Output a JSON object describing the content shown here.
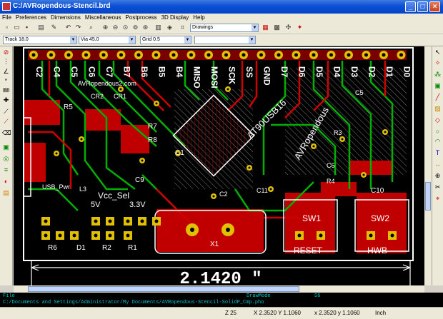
{
  "window": {
    "title": "C:/AVRopendous-Stencil.brd"
  },
  "menu": [
    "File",
    "Preferences",
    "Dimensions",
    "Miscellaneous",
    "Postprocess",
    "3D Display",
    "Help"
  ],
  "toolbar2": {
    "track": "Track 18.0",
    "via": "Via 45.0",
    "grid": "Grid 0.5",
    "empty": ""
  },
  "toolbar1": {
    "layer_combo": "Drawings"
  },
  "board": {
    "top_header_labels": [
      "C2",
      "C4",
      "C5",
      "C6",
      "C7",
      "B7",
      "B6",
      "B5",
      "B4",
      "MISO",
      "MOSI",
      "SCK",
      "SS",
      "GND",
      "D7",
      "D6",
      "D5",
      "D4",
      "D3",
      "D2",
      "D1",
      "D0"
    ],
    "components": [
      "R5",
      "CR2",
      "CR1",
      "R7",
      "R8",
      "C9",
      "C1",
      "C2",
      "C11",
      "C6",
      "R3",
      "R4",
      "C5",
      "C10",
      "USB_Pwr",
      "L3",
      "Vcc_Sel",
      "5V",
      "3.3V",
      "R6",
      "D1",
      "R2",
      "R1",
      "X1",
      "SW1",
      "SW2",
      "RESET",
      "HWB",
      "AT90USB16",
      "AVRopendous",
      "AVRopendous2.com"
    ],
    "dimension": "2.1420 ″"
  },
  "messages": {
    "line1_left": "File",
    "line1_mid": "DrawMode",
    "line1_right": "S6",
    "line2": "C:/Documents and Settings/Administrator/My Documents/AVRopendous-Stencil-SolidP_Cmp.pho"
  },
  "status": {
    "zoom": "Z 25",
    "abs": "X 2.3520  Y 1.1060",
    "rel": "x 2.3520  y 1.1060",
    "units": "Inch"
  },
  "colors": {
    "copper_top": "#cc0000",
    "copper_bottom": "#00a000",
    "silkscreen": "#ffffff",
    "pad": "#e0c000",
    "titlebar": "#0a4fd6"
  }
}
